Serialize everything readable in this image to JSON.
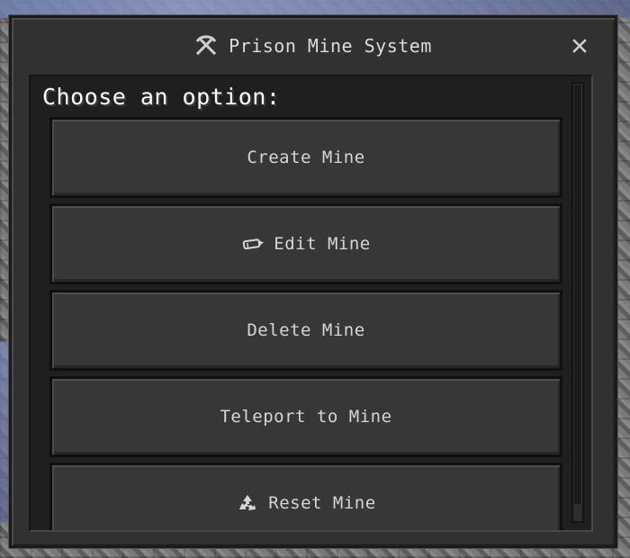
{
  "window": {
    "title": "Prison Mine System",
    "title_icon": "crossed-pickaxes-icon",
    "close_icon": "close-icon"
  },
  "panel": {
    "prompt": "Choose an option:"
  },
  "options": [
    {
      "label": "Create Mine",
      "icon": null
    },
    {
      "label": "Edit Mine",
      "icon": "pencil-icon"
    },
    {
      "label": "Delete Mine",
      "icon": null
    },
    {
      "label": "Teleport to Mine",
      "icon": null
    },
    {
      "label": "Reset Mine",
      "icon": "recycle-icon"
    }
  ],
  "colors": {
    "window_bg": "#313131",
    "button_bg": "#373737",
    "text": "#d6d6d6",
    "prompt_text": "#ffffff"
  }
}
